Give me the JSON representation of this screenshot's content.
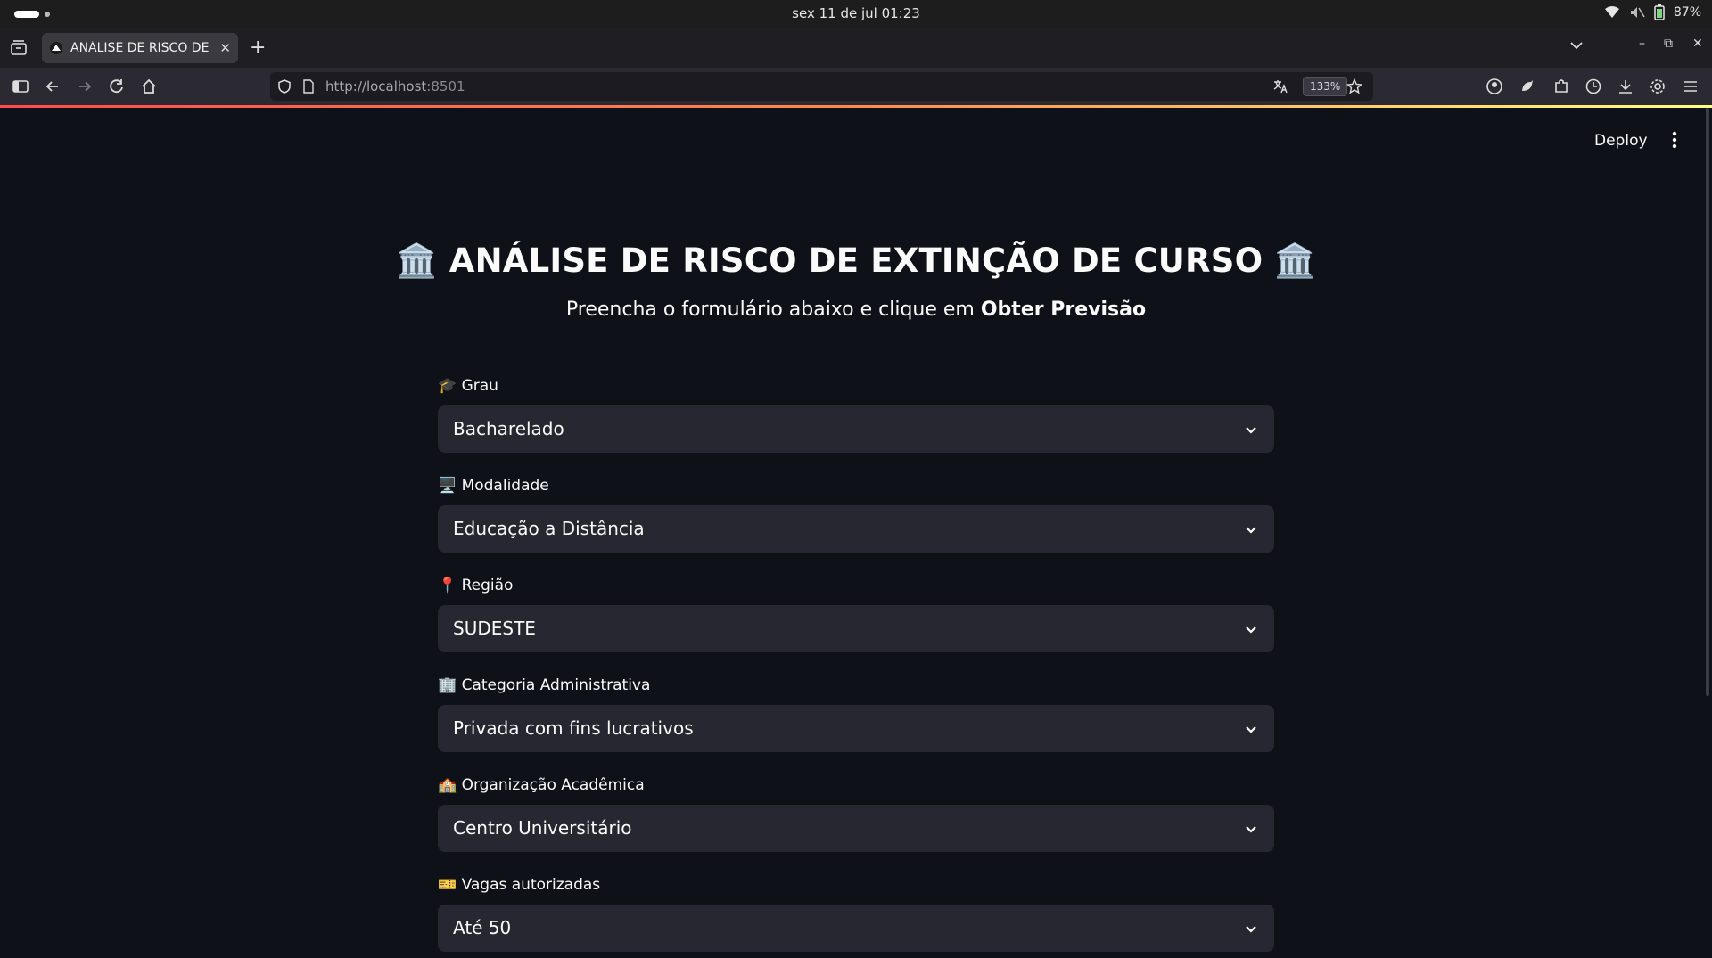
{
  "os": {
    "clock": "sex 11 de jul  01:23",
    "battery": "87%"
  },
  "browser": {
    "tab_title": "ANÁLISE DE RISCO DE EX",
    "url_host": "http://localhost",
    "url_port": ":8501",
    "zoom": "133%"
  },
  "app": {
    "deploy_label": "Deploy",
    "title": "🏛️ ANÁLISE DE RISCO DE EXTINÇÃO DE CURSO 🏛️",
    "subtitle_prefix": "Preencha o formulário abaixo e clique em ",
    "subtitle_bold": "Obter Previsão",
    "fields": [
      {
        "label": "🎓 Grau",
        "value": "Bacharelado"
      },
      {
        "label": "🖥️ Modalidade",
        "value": "Educação a Distância"
      },
      {
        "label": "📍 Região",
        "value": "SUDESTE"
      },
      {
        "label": "🏢 Categoria Administrativa",
        "value": "Privada com fins lucrativos"
      },
      {
        "label": "🏫 Organização Acadêmica",
        "value": "Centro Universitário"
      },
      {
        "label": "🎫 Vagas autorizadas",
        "value": "Até 50"
      }
    ]
  }
}
